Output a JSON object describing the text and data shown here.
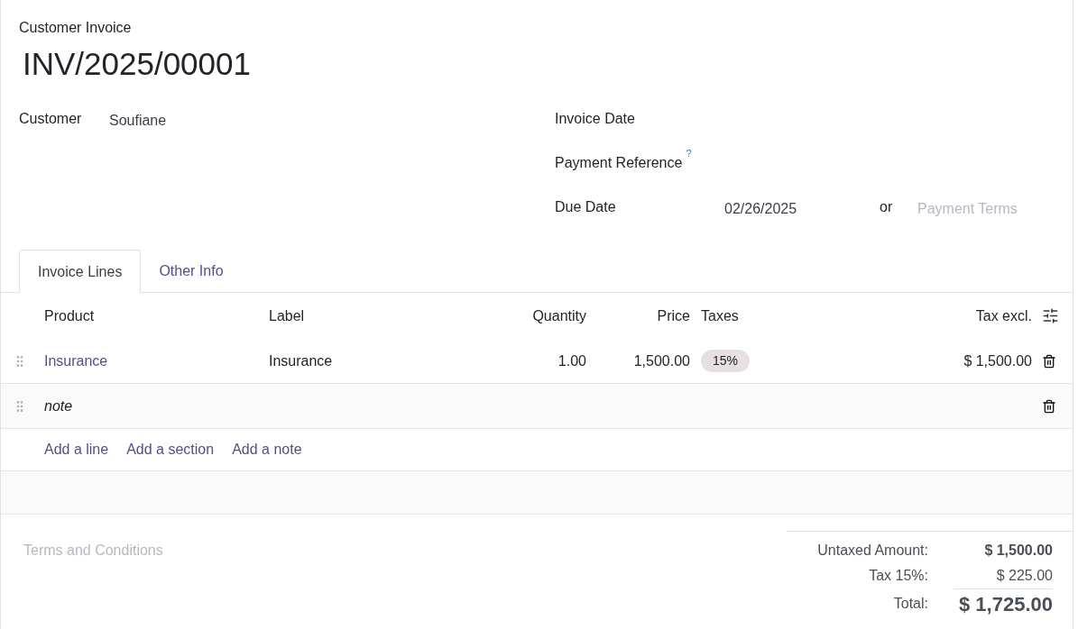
{
  "header": {
    "kind_label": "Customer Invoice",
    "number": "INV/2025/00001"
  },
  "left_fields": [
    {
      "label": "Customer",
      "value": "Soufiane"
    }
  ],
  "right_fields": [
    {
      "label": "Invoice Date"
    },
    {
      "label": "Payment Reference",
      "help": "?"
    },
    {
      "label": "Due Date",
      "value": "02/26/2025",
      "joiner": "or",
      "placeholder": "Payment Terms"
    }
  ],
  "tabs": [
    {
      "label": "Invoice Lines",
      "selected": true
    },
    {
      "label": "Other Info",
      "selected": false
    }
  ],
  "lines": {
    "columns": [
      "Product",
      "Label",
      "Quantity",
      "Price",
      "Taxes",
      "Tax excl."
    ],
    "rows": [
      {
        "kind": "product",
        "product": "Insurance",
        "label": "Insurance",
        "quantity": "1.00",
        "price": "1,500.00",
        "taxes": [
          "15%"
        ],
        "subtotal": "$ 1,500.00"
      },
      {
        "kind": "note",
        "text": "note"
      }
    ],
    "actions": [
      "Add a line",
      "Add a section",
      "Add a note"
    ]
  },
  "terms": {
    "placeholder": "Terms and Conditions"
  },
  "totals": [
    {
      "kind": "subtotal",
      "label": "Untaxed Amount:",
      "value": "$ 1,500.00"
    },
    {
      "kind": "tax",
      "label": "Tax 15%:",
      "value": "$ 225.00"
    },
    {
      "kind": "total",
      "label": "Total:",
      "value": "$ 1,725.00"
    }
  ]
}
